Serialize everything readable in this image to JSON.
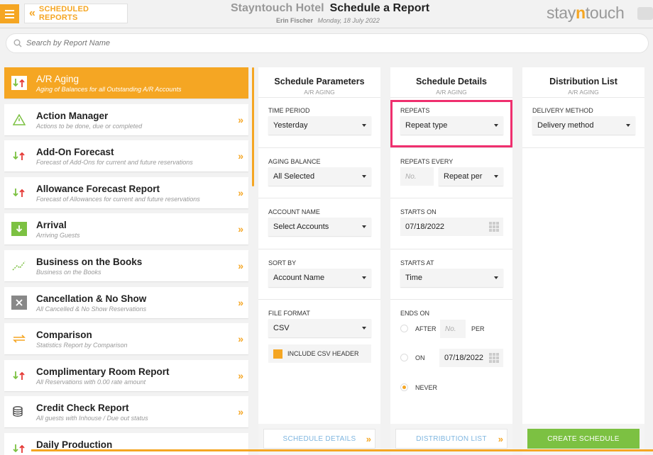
{
  "header": {
    "back_label": "SCHEDULED REPORTS",
    "hotel_name": "Stayntouch Hotel",
    "page_title": "Schedule a Report",
    "user": "Erin Fischer",
    "date": "Monday, 18 July 2022",
    "logo_pre": "stay",
    "logo_n": "n",
    "logo_post": "touch"
  },
  "search": {
    "placeholder": "Search by Report Name"
  },
  "reports": [
    {
      "name": "A/R Aging",
      "desc": "Aging of Balances for all Outstanding A/R Accounts",
      "icon": "up-down-arrows-icon",
      "active": true
    },
    {
      "name": "Action Manager",
      "desc": "Actions to be done, due or completed",
      "icon": "warning-icon"
    },
    {
      "name": "Add-On Forecast",
      "desc": "Forecast of Add-Ons for current and future reservations",
      "icon": "up-down-arrows-icon"
    },
    {
      "name": "Allowance Forecast Report",
      "desc": "Forecast of Allowances for current and future reservations",
      "icon": "up-down-arrows-icon"
    },
    {
      "name": "Arrival",
      "desc": "Arriving Guests",
      "icon": "arrival-icon"
    },
    {
      "name": "Business on the Books",
      "desc": "Business on the Books",
      "icon": "trend-icon"
    },
    {
      "name": "Cancellation & No Show",
      "desc": "All Cancelled & No Show Reservations",
      "icon": "cancel-icon"
    },
    {
      "name": "Comparison",
      "desc": "Statistics Report by Comparison",
      "icon": "compare-icon"
    },
    {
      "name": "Complimentary Room Report",
      "desc": "All Reservations with 0.00 rate amount",
      "icon": "up-down-arrows-icon"
    },
    {
      "name": "Credit Check Report",
      "desc": "All guests with Inhouse / Due out status",
      "icon": "coins-icon"
    },
    {
      "name": "Daily Production",
      "desc": "",
      "icon": "up-down-arrows-icon"
    }
  ],
  "params": {
    "title": "Schedule Parameters",
    "sub": "A/R AGING",
    "time_period_label": "TIME PERIOD",
    "time_period_value": "Yesterday",
    "aging_balance_label": "AGING BALANCE",
    "aging_balance_value": "All Selected",
    "account_name_label": "ACCOUNT NAME",
    "account_name_value": "Select Accounts",
    "sort_by_label": "SORT BY",
    "sort_by_value": "Account Name",
    "file_format_label": "FILE FORMAT",
    "file_format_value": "CSV",
    "csv_header_label": "INCLUDE CSV HEADER",
    "footer_btn": "SCHEDULE DETAILS"
  },
  "details": {
    "title": "Schedule Details",
    "sub": "A/R AGING",
    "repeats_label": "REPEATS",
    "repeats_value": "Repeat type",
    "repeats_every_label": "REPEATS EVERY",
    "repeats_every_placeholder": "No.",
    "repeats_every_value": "Repeat per",
    "starts_on_label": "STARTS ON",
    "starts_on_value": "07/18/2022",
    "starts_at_label": "STARTS AT",
    "starts_at_value": "Time",
    "ends_on_label": "ENDS ON",
    "after_label": "AFTER",
    "after_placeholder": "No.",
    "per_label": "PER",
    "on_label": "ON",
    "on_value": "07/18/2022",
    "never_label": "NEVER",
    "footer_btn": "DISTRIBUTION LIST"
  },
  "distribution": {
    "title": "Distribution List",
    "sub": "A/R AGING",
    "delivery_label": "DELIVERY METHOD",
    "delivery_value": "Delivery method",
    "footer_btn": "CREATE SCHEDULE"
  },
  "colors": {
    "accent": "#f5a623",
    "green": "#7cc142",
    "highlight": "#ef2f6e",
    "link": "#7fb6e0"
  }
}
